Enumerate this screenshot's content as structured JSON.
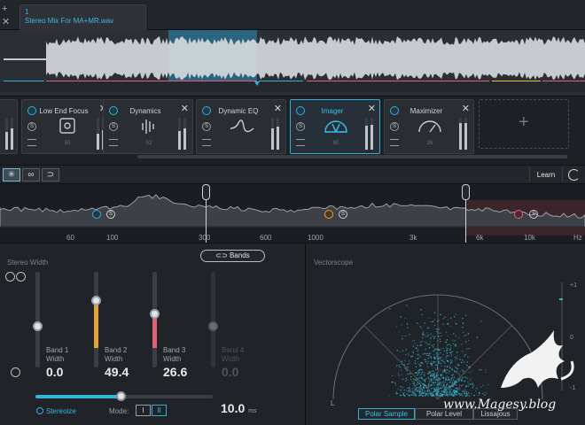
{
  "topbar": {
    "add_label": "+",
    "close_label": "✕",
    "file_index": "1",
    "file_name": "Stereo Mix For MA+MR.wav"
  },
  "modules": [
    {
      "name": "Low End Focus",
      "value": "50"
    },
    {
      "name": "Dynamics",
      "value": "52"
    },
    {
      "name": "Dynamic EQ",
      "value": ""
    },
    {
      "name": "Imager",
      "value": "90"
    },
    {
      "name": "Maximizer",
      "value": "26"
    }
  ],
  "module_header": {
    "learn_label": "Learn"
  },
  "spectrum": {
    "freq_labels": [
      "60",
      "100",
      "300",
      "600",
      "1000",
      "3k",
      "6k",
      "10k",
      "Hz"
    ]
  },
  "stereo_width": {
    "title": "Stereo Width",
    "bands_label": "Bands",
    "bands": [
      {
        "label": "Band 1",
        "sub": "Width",
        "value": "0.0",
        "enabled": true
      },
      {
        "label": "Band 2",
        "sub": "Width",
        "value": "49.4",
        "enabled": true
      },
      {
        "label": "Band 3",
        "sub": "Width",
        "value": "26.6",
        "enabled": true
      },
      {
        "label": "Band 4",
        "sub": "Width",
        "value": "0.0",
        "enabled": false
      }
    ],
    "stereoize_label": "Stereoize",
    "mode_label": "Mode:",
    "mode_options": [
      "I",
      "II"
    ],
    "delay_value": "10.0",
    "delay_unit": "ms"
  },
  "vectorscope": {
    "title": "Vectorscope",
    "l_label": "L",
    "tabs": [
      "Polar Sample",
      "Polar Level",
      "Lissajous"
    ],
    "scale": [
      "+1",
      "0",
      "-1"
    ]
  },
  "watermark": "www.Magesy.blog"
}
